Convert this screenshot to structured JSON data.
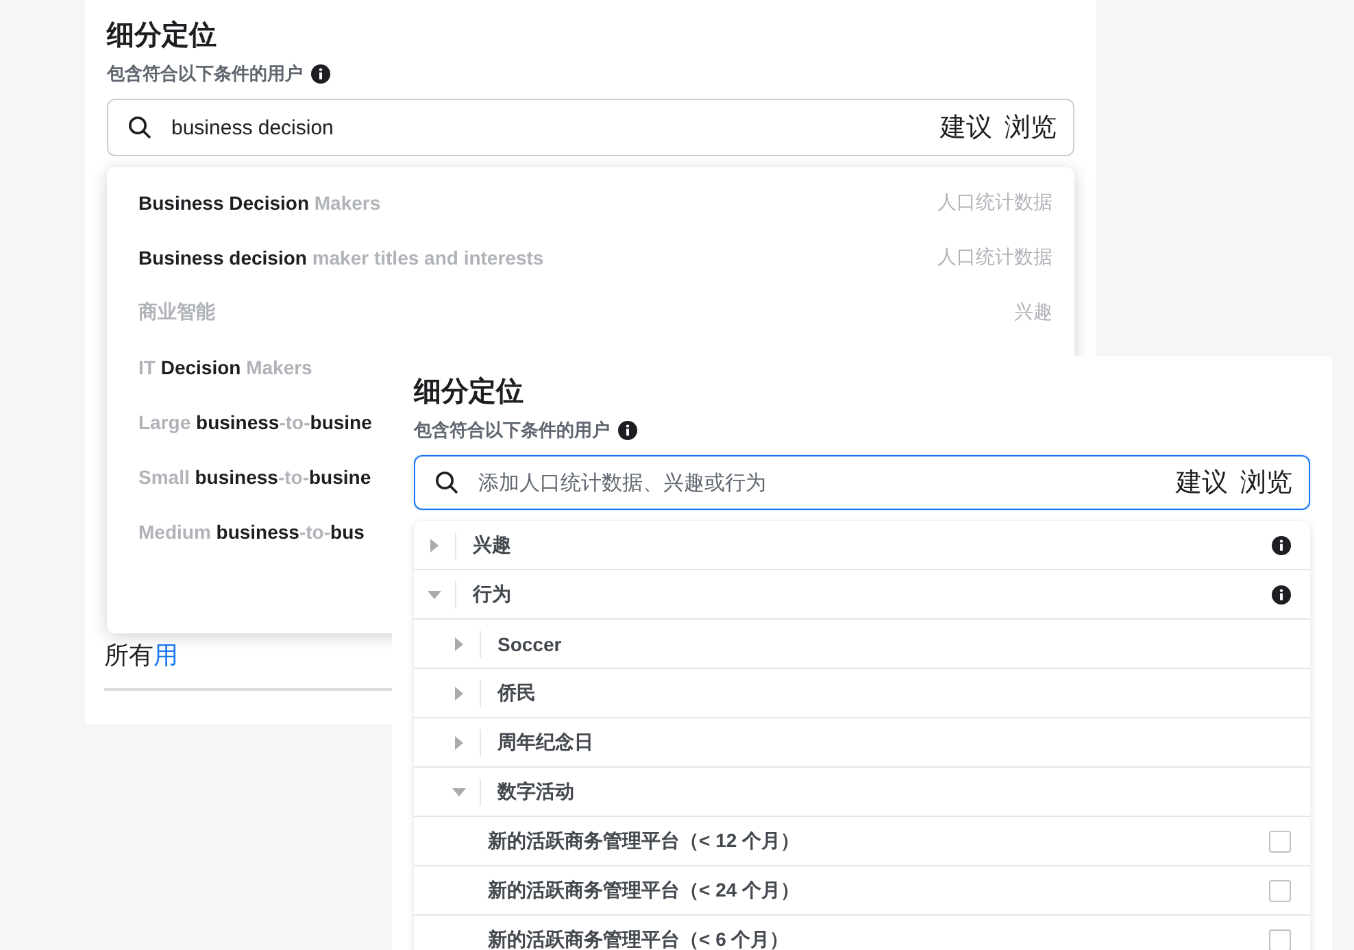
{
  "panels": [
    {
      "title": "细分定位",
      "subtitle": "包含符合以下条件的用户",
      "info": true,
      "search": {
        "value": "business decision",
        "focused": false
      },
      "search_links": [
        "建议",
        "浏览"
      ],
      "suggestions": [
        {
          "text": "**Business Decision** Makers",
          "category": "人口统计数据"
        },
        {
          "text": "**Business decision** maker titles and interests",
          "category": "人口统计数据"
        },
        {
          "text": "商业智能",
          "category": "兴趣"
        },
        {
          "text": "IT **Decision** Makers"
        },
        {
          "text": "Large **business**-to-**busine**"
        },
        {
          "text": "Small **business**-to-**busine**"
        },
        {
          "text": "Medium **business**-to-**bus**"
        }
      ],
      "footer": {
        "text": "所有",
        "link": "用"
      }
    },
    {
      "title": "细分定位",
      "subtitle": "包含符合以下条件的用户",
      "info": true,
      "search": {
        "placeholder": "添加人口统计数据、兴趣或行为",
        "focused": true
      },
      "search_links": [
        "建议",
        "浏览"
      ],
      "tree": [
        {
          "kind": "group",
          "label": "兴趣",
          "expanded": false,
          "info": true
        },
        {
          "kind": "group",
          "label": "行为",
          "expanded": true,
          "info": true,
          "children": [
            {
              "kind": "group",
              "label": "Soccer",
              "expanded": false
            },
            {
              "kind": "group",
              "label": "侨民",
              "expanded": false
            },
            {
              "kind": "group",
              "label": "周年纪念日",
              "expanded": false
            },
            {
              "kind": "group",
              "label": "数字活动",
              "expanded": true,
              "children": [
                {
                  "kind": "checkbox",
                  "label": "新的活跃商务管理平台（< 12 个月）",
                  "checked": false
                },
                {
                  "kind": "checkbox",
                  "label": "新的活跃商务管理平台（< 24 个月）",
                  "checked": false
                },
                {
                  "kind": "checkbox",
                  "label": "新的活跃商务管理平台（< 6 个月）",
                  "checked": false
                }
              ]
            }
          ]
        }
      ]
    }
  ]
}
